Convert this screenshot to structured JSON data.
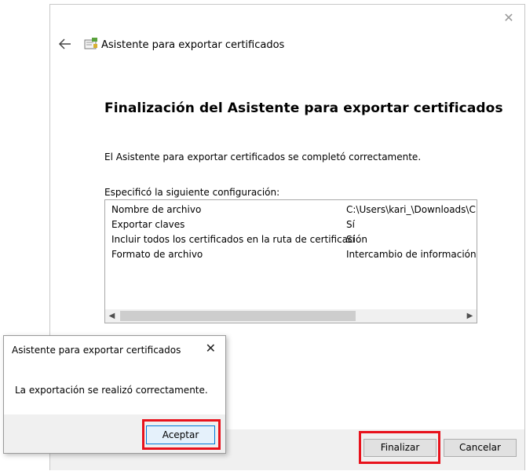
{
  "wizard": {
    "title": "Asistente para exportar certificados",
    "heading": "Finalización del Asistente para exportar certificados",
    "completed_text": "El Asistente para exportar certificados se completó correctamente.",
    "spec_label": "Especificó la siguiente configuración:",
    "rows": [
      {
        "key": "Nombre de archivo",
        "value": "C:\\Users\\kari_\\Downloads\\CEF"
      },
      {
        "key": "Exportar claves",
        "value": "Sí"
      },
      {
        "key": "Incluir todos los certificados en la ruta de certificación",
        "value": "Sí"
      },
      {
        "key": "Formato de archivo",
        "value": "Intercambio de información pe"
      }
    ],
    "finish_label": "Finalizar",
    "cancel_label": "Cancelar"
  },
  "dialog": {
    "title": "Asistente para exportar certificados",
    "message": "La exportación se realizó correctamente.",
    "ok_label": "Aceptar"
  },
  "colors": {
    "highlight": "#e8121c",
    "focus_border": "#0078d7",
    "button_face": "#e1e1e1",
    "bar_bg": "#f0f0f0"
  },
  "icons": {
    "back": "left-arrow-icon",
    "certificate": "certificate-icon",
    "close": "close-icon",
    "scroll_left": "chevron-left-icon",
    "scroll_right": "chevron-right-icon"
  }
}
